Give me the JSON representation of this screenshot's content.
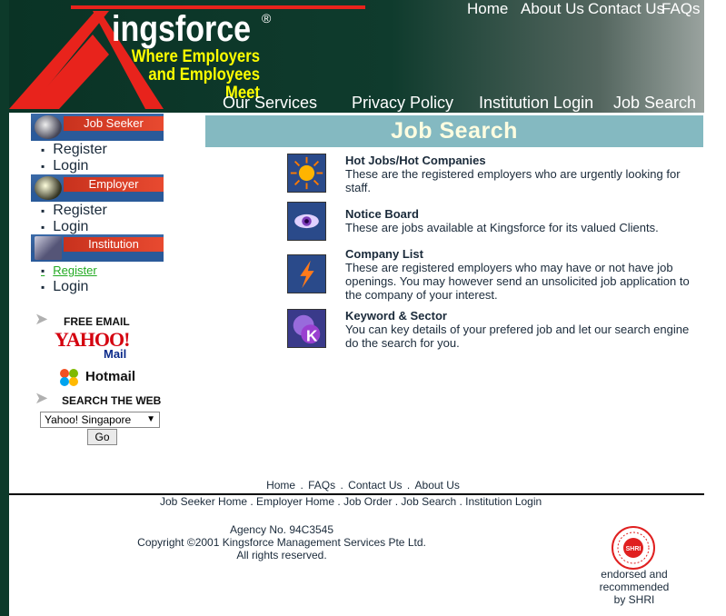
{
  "header": {
    "brand": "ingsforce",
    "brand_reg": "®",
    "tagline_1": "Where Employers",
    "tagline_2": "and Employees Meet",
    "top_nav": [
      "Home",
      "About Us",
      "Contact Us",
      "FAQs"
    ],
    "main_nav": [
      "Our Services",
      "Privacy Policy",
      "Institution Login",
      "Job Search"
    ]
  },
  "sidebar": {
    "job_seeker": {
      "label": "Job Seeker",
      "items": [
        "Register",
        "Login"
      ]
    },
    "employer": {
      "label": "Employer",
      "items": [
        "Register",
        "Login"
      ]
    },
    "institution": {
      "label": "Institution",
      "items": [
        "Register",
        "Login"
      ]
    },
    "free_email": "FREE EMAIL",
    "yahoo": "YAHOO!",
    "yahoo_mail": "Mail",
    "hotmail": "Hotmail",
    "search_web": "SEARCH THE WEB",
    "search_select": "Yahoo! Singapore",
    "go": "Go"
  },
  "main": {
    "title": "Job Search",
    "features": [
      {
        "title": "Hot Jobs/Hot Companies",
        "desc": "These are the registered employers who are urgently looking for staff."
      },
      {
        "title": "Notice Board",
        "desc": "These are jobs available at Kingsforce for its valued Clients."
      },
      {
        "title": "Company List",
        "desc": "These are registered employers who may have or not have job openings. You may however send an unsolicited job application to the company of your interest."
      },
      {
        "title": "Keyword & Sector",
        "desc": "You can key details of your prefered job and let our search engine do the search for you."
      }
    ]
  },
  "footer": {
    "links": [
      "Home",
      "FAQs",
      "Contact Us",
      "About Us"
    ],
    "links2": "Job Seeker Home . Employer Home . Job Order . Job Search . Institution Login",
    "agency": "Agency No. 94C3545",
    "copyright": "Copyright ©2001 Kingsforce Management Services Pte Ltd.",
    "rights": "All rights reserved.",
    "endorse_1": "endorsed and",
    "endorse_2": "recommended",
    "endorse_3": "by SHRI"
  },
  "colors": {
    "header_green": "#0f3b2d",
    "title_bar": "#84b9c1",
    "brand_yellow": "#ffff00",
    "logo_red": "#e8231c"
  }
}
